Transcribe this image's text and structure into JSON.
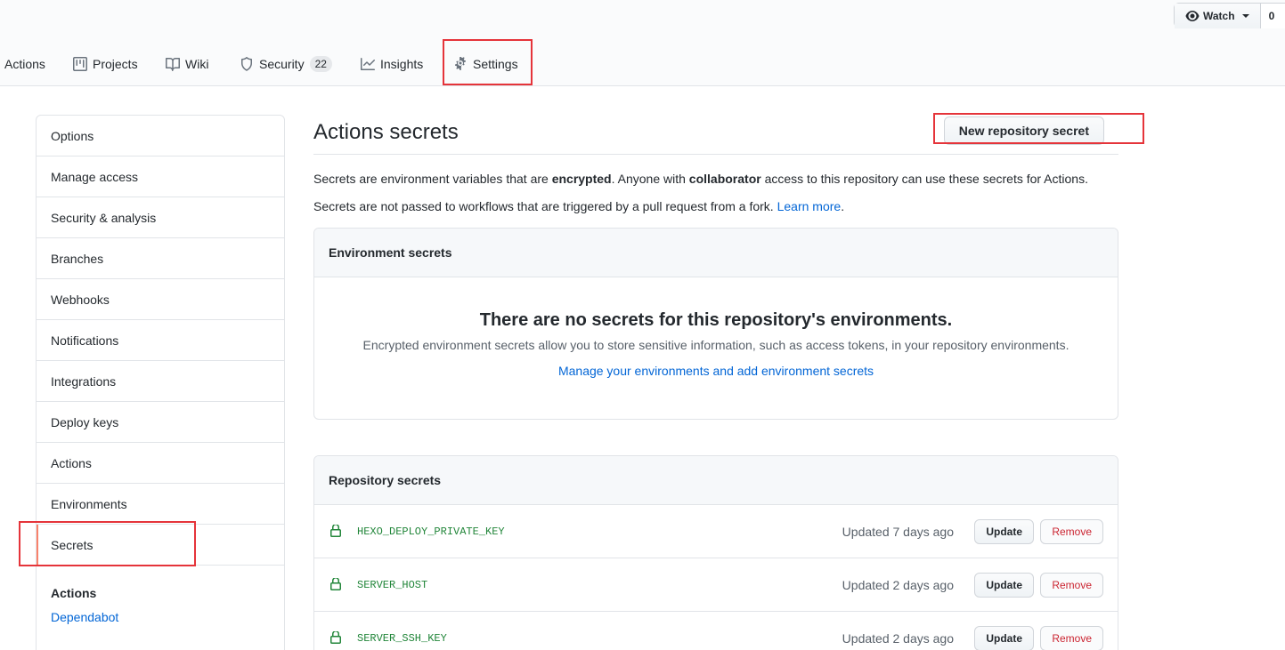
{
  "watch": {
    "label": "Watch",
    "count": "0"
  },
  "nav": {
    "actions": "Actions",
    "projects": "Projects",
    "wiki": "Wiki",
    "security": "Security",
    "security_count": "22",
    "insights": "Insights",
    "settings": "Settings"
  },
  "sidebar": {
    "items": [
      {
        "label": "Options"
      },
      {
        "label": "Manage access"
      },
      {
        "label": "Security & analysis"
      },
      {
        "label": "Branches"
      },
      {
        "label": "Webhooks"
      },
      {
        "label": "Notifications"
      },
      {
        "label": "Integrations"
      },
      {
        "label": "Deploy keys"
      },
      {
        "label": "Actions"
      },
      {
        "label": "Environments"
      },
      {
        "label": "Secrets"
      }
    ],
    "section_title": "Actions",
    "section_link": "Dependabot"
  },
  "main": {
    "title": "Actions secrets",
    "new_secret_button": "New repository secret",
    "desc1_a": "Secrets are environment variables that are ",
    "desc1_b": "encrypted",
    "desc1_c": ". Anyone with ",
    "desc1_d": "collaborator",
    "desc1_e": " access to this repository can use these secrets for Actions.",
    "desc2_a": "Secrets are not passed to workflows that are triggered by a pull request from a fork. ",
    "desc2_link": "Learn more",
    "desc2_end": "."
  },
  "environment_secrets": {
    "header": "Environment secrets",
    "blank_title": "There are no secrets for this repository's environments.",
    "blank_text": "Encrypted environment secrets allow you to store sensitive information, such as access tokens, in your repository environments.",
    "blank_link": "Manage your environments and add environment secrets"
  },
  "repository_secrets": {
    "header": "Repository secrets",
    "rows": [
      {
        "name": "HEXO_DEPLOY_PRIVATE_KEY",
        "updated": "Updated 7 days ago",
        "update": "Update",
        "remove": "Remove"
      },
      {
        "name": "SERVER_HOST",
        "updated": "Updated 2 days ago",
        "update": "Update",
        "remove": "Remove"
      },
      {
        "name": "SERVER_SSH_KEY",
        "updated": "Updated 2 days ago",
        "update": "Update",
        "remove": "Remove"
      }
    ]
  },
  "colors": {
    "highlight": "#e5343a",
    "link": "#0366d6",
    "secret_name": "#22863a",
    "remove": "#cb2431"
  }
}
